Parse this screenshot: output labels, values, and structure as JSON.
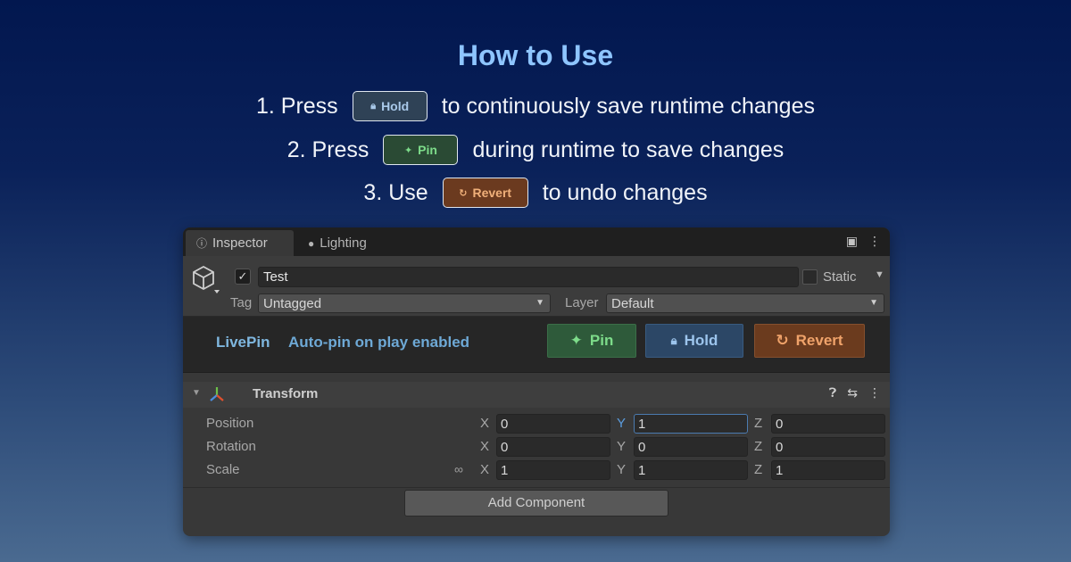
{
  "headline": "How to Use",
  "steps": [
    {
      "prefix": "1. Press",
      "chip": "Hold",
      "suffix": "to continuously save runtime changes"
    },
    {
      "prefix": "2. Press",
      "chip": "Pin",
      "suffix": "during runtime to save changes"
    },
    {
      "prefix": "3. Use",
      "chip": "Revert",
      "suffix": "to undo changes"
    }
  ],
  "inspector": {
    "tabs": [
      {
        "label": "Inspector",
        "icon": "info-icon"
      },
      {
        "label": "Lighting",
        "icon": "lightbulb-icon"
      }
    ],
    "gameobject": {
      "name": "Test",
      "active": true,
      "static_label": "Static",
      "tag_label": "Tag",
      "tag_value": "Untagged",
      "layer_label": "Layer",
      "layer_value": "Default"
    },
    "livepin": {
      "title": "LivePin",
      "status": "Auto-pin on play enabled",
      "pin_label": "Pin",
      "hold_label": "Hold",
      "revert_label": "Revert"
    },
    "transform": {
      "title": "Transform",
      "rows": [
        {
          "label": "Position",
          "x": "0",
          "y": "1",
          "z": "0"
        },
        {
          "label": "Rotation",
          "x": "0",
          "y": "0",
          "z": "0"
        },
        {
          "label": "Scale",
          "x": "1",
          "y": "1",
          "z": "1"
        }
      ],
      "axis_x": "X",
      "axis_y": "Y",
      "axis_z": "Z"
    },
    "add_component_label": "Add Component"
  },
  "colors": {
    "headline": "#8ec5ff",
    "pin": "#7ddc8a",
    "hold": "#9cc4ec",
    "revert": "#f0a36a"
  }
}
